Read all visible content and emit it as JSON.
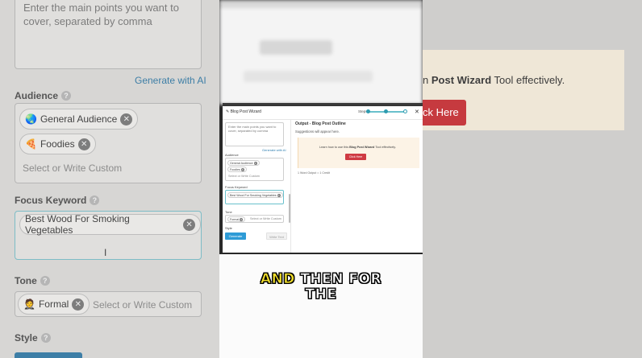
{
  "bg_left": {
    "textarea_placeholder": "Enter the main points you want to cover, separated by comma",
    "generate_link": "Generate with AI",
    "audience_label": "Audience",
    "chips": [
      "General Audience",
      "Foodies"
    ],
    "custom_placeholder": "Select or Write Custom",
    "focus_label": "Focus Keyword",
    "keyword": "Best Wood For Smoking Vegetables",
    "tone_label": "Tone",
    "tone_chip": "Formal",
    "style_label": "Style",
    "help": "?"
  },
  "bg_right": {
    "learn_prefix": "n",
    "learn_bold": "Post Wizard",
    "learn_suffix": "Tool effectively.",
    "button": "ck Here"
  },
  "dialog": {
    "title": "Blog Post Wizard",
    "steps_label": "Steps",
    "close": "✕",
    "textarea_placeholder": "Enter the main points you want to cover, separated by comma",
    "generate_link": "Generate with AI",
    "audience_label": "Audience",
    "audience_chips": [
      "General Audience",
      "Foodies"
    ],
    "custom_placeholder": "Select or Write Custom",
    "focus_label": "Focus Keyword",
    "keyword": "Best Wood For Smoking Vegetables",
    "tone_label": "Tone",
    "tone_chip": "Formal",
    "style_label": "Style",
    "generate_button": "Generate",
    "write_button": "Write Text",
    "output_title": "Output - Blog Post Outline",
    "output_sub": "Suggestions will appear here.",
    "learn_prefix": "Learn how to use this",
    "learn_bold": "Blog Post Wizard",
    "learn_suffix": "Tool effectively.",
    "click_button": "Click Here",
    "word_count": "1 Word Output = 1 Credit"
  },
  "caption": {
    "highlight": "AND",
    "line1_rest": "THEN FOR",
    "line2": "THE"
  },
  "colors": {
    "accent_teal": "#2e9bb0",
    "button_red": "#c63a3f",
    "button_blue": "#2e9bd6",
    "caption_yellow": "#f1de2a"
  }
}
